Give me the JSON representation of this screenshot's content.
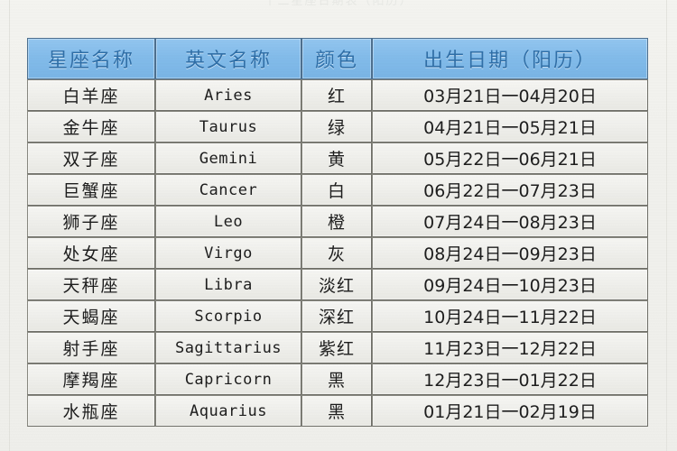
{
  "caption": "十二星座日期表（阳历）",
  "colors": {
    "header_blue": "#83bcea",
    "header_text": "#2f6fa8",
    "row_bg": "#eeeeea",
    "border": "#6f6f68",
    "page_bg": "#f1f1ed"
  },
  "table": {
    "columns": [
      {
        "key": "name",
        "label": "星座名称"
      },
      {
        "key": "eng",
        "label": "英文名称"
      },
      {
        "key": "color",
        "label": "颜色"
      },
      {
        "key": "date",
        "label": "出生日期（阳历）"
      }
    ],
    "rows": [
      {
        "name": "白羊座",
        "eng": "Aries",
        "color": "红",
        "date": "03月21日一04月20日"
      },
      {
        "name": "金牛座",
        "eng": "Taurus",
        "color": "绿",
        "date": "04月21日一05月21日"
      },
      {
        "name": "双子座",
        "eng": "Gemini",
        "color": "黄",
        "date": "05月22日一06月21日"
      },
      {
        "name": "巨蟹座",
        "eng": "Cancer",
        "color": "白",
        "date": "06月22日一07月23日"
      },
      {
        "name": "狮子座",
        "eng": "Leo",
        "color": "橙",
        "date": "07月24日一08月23日"
      },
      {
        "name": "处女座",
        "eng": "Virgo",
        "color": "灰",
        "date": "08月24日一09月23日"
      },
      {
        "name": "天秤座",
        "eng": "Libra",
        "color": "淡红",
        "date": "09月24日一10月23日"
      },
      {
        "name": "天蝎座",
        "eng": "Scorpio",
        "color": "深红",
        "date": "10月24日一11月22日"
      },
      {
        "name": "射手座",
        "eng": "Sagittarius",
        "color": "紫红",
        "date": "11月23日一12月22日"
      },
      {
        "name": "摩羯座",
        "eng": "Capricorn",
        "color": "黑",
        "date": "12月23日一01月22日"
      },
      {
        "name": "水瓶座",
        "eng": "Aquarius",
        "color": "黑",
        "date": "01月21日一02月19日"
      }
    ]
  }
}
